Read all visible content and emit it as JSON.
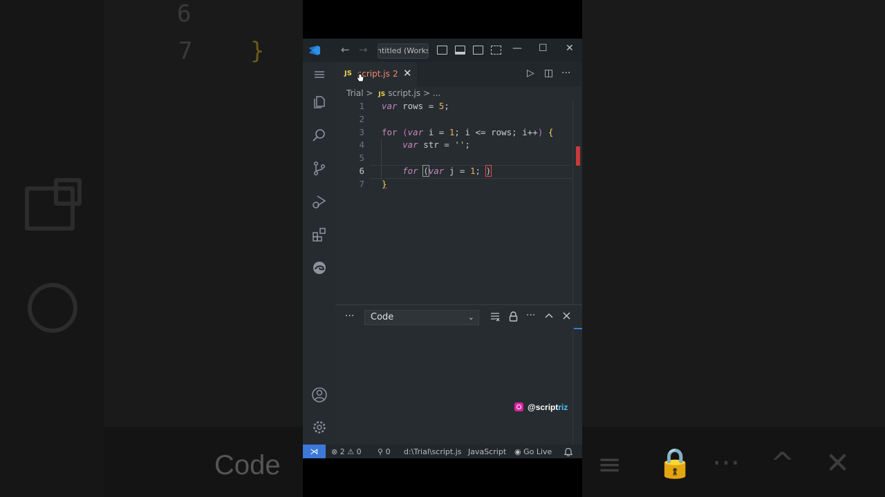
{
  "window": {
    "title_search": "ntitled (Works",
    "nav_back": "←",
    "nav_forward": "→",
    "minimize": "—",
    "maximize": "☐",
    "close": "✕"
  },
  "tab": {
    "lang_badge": "JS",
    "filename": "script.js",
    "problems": "2",
    "close": "✕"
  },
  "tab_actions": {
    "run": "▷",
    "split": "◫",
    "more": "···"
  },
  "breadcrumb": {
    "folder": "Trial",
    "sep": ">",
    "lang_badge": "JS",
    "file": "script.js",
    "more": "> ..."
  },
  "editor": {
    "line_numbers": [
      "1",
      "2",
      "3",
      "4",
      "5",
      "6",
      "7"
    ],
    "current_line": "6"
  },
  "panel": {
    "more": "···",
    "output_channel": "Code"
  },
  "watermark": {
    "handle_prefix": "@script",
    "handle_highlight": "riz"
  },
  "statusbar": {
    "remote": "⋊",
    "errors": "2",
    "warnings": "0",
    "ports": "0",
    "path": "d:\\Trial\\script.js",
    "language": "JavaScript",
    "live": "Go Live"
  },
  "background": {
    "line6": "6",
    "line7": "7",
    "brace": "}",
    "code_word": "Code"
  },
  "colors": {
    "accent": "#3b78d8",
    "error": "#f48771",
    "js_badge": "#e8d44d",
    "keyword": "#c586c0"
  }
}
